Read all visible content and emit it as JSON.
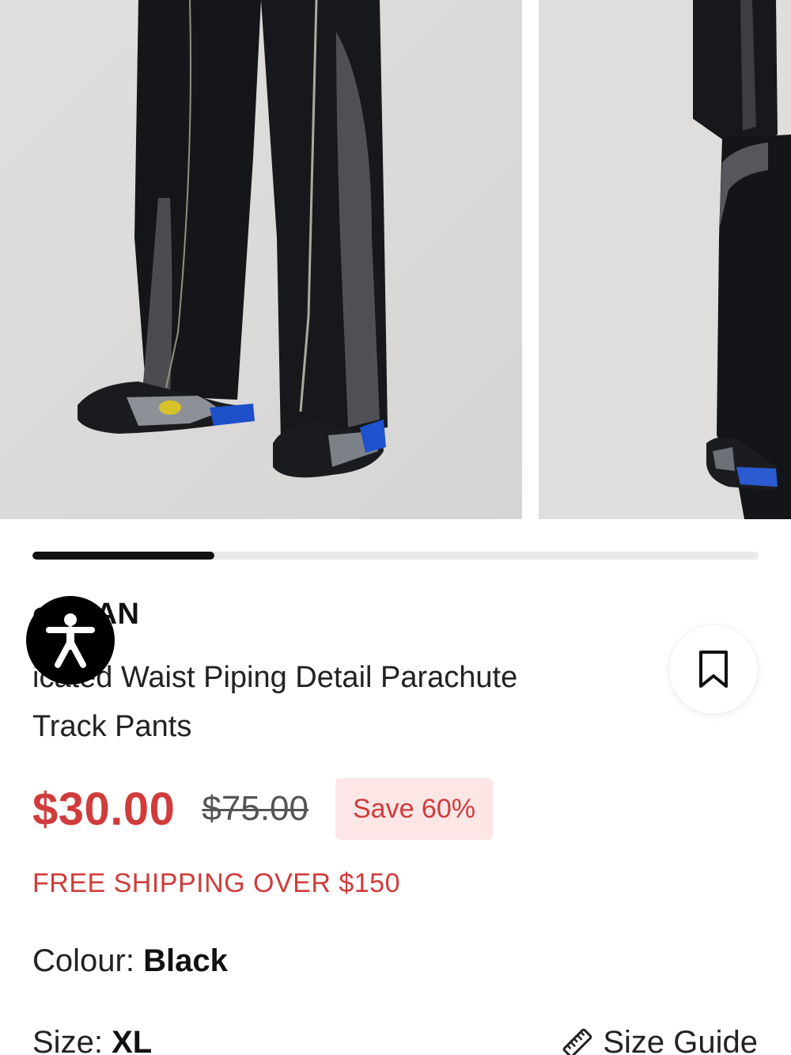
{
  "gallery": {
    "images": [
      {
        "alt": "Black track pants with grey panel, front view"
      },
      {
        "alt": "Black track pants side view"
      }
    ],
    "progress": 0.25
  },
  "product": {
    "brand": "ooMAN",
    "title": "icated Waist Piping Detail Parachute Track Pants",
    "price_now": "$30.00",
    "price_was": "$75.00",
    "save_label": "Save 60%",
    "shipping_note": "FREE SHIPPING OVER $150",
    "colour_label": "Colour:",
    "colour_value": "Black",
    "size_label": "Size:",
    "size_value": "XL",
    "size_guide_label": "Size Guide"
  },
  "colors": {
    "accent": "#d03c3c",
    "badge_bg": "#fde6e6"
  },
  "icons": {
    "accessibility": "accessibility-icon",
    "bookmark": "bookmark-icon",
    "size_guide": "ruler-icon"
  }
}
